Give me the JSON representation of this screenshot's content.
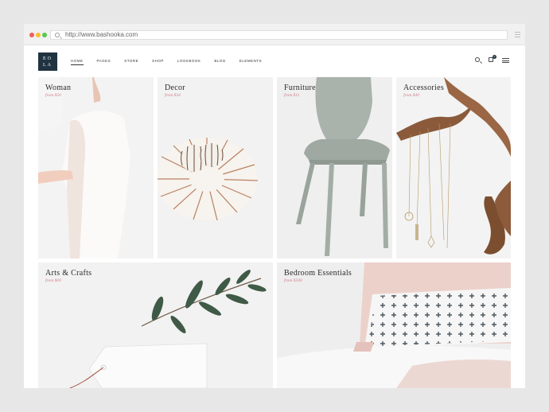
{
  "browser": {
    "url": "http://www.bashooka.com"
  },
  "header": {
    "logo": {
      "line1": "EO",
      "line2": "LA"
    },
    "nav": [
      "HOME",
      "PAGES",
      "STORE",
      "SHOP",
      "LOOKBOOK",
      "BLOG",
      "ELEMENTS"
    ],
    "active_nav": "HOME",
    "icons": [
      "search-icon",
      "shopping-bag-icon",
      "hamburger-menu-icon"
    ],
    "cart_count": "0"
  },
  "categories": [
    {
      "title": "Woman",
      "price": "from $50"
    },
    {
      "title": "Decor",
      "price": "from $34"
    },
    {
      "title": "Furniture",
      "price": "from $11"
    },
    {
      "title": "Accessories",
      "price": "from $40"
    },
    {
      "title": "Arts & Crafts",
      "price": "from $69"
    },
    {
      "title": "Bedroom Essentials",
      "price": "from $330"
    }
  ],
  "colors": {
    "logo_bg": "#1f3340",
    "price_accent": "#d07c8a",
    "page_bg": "#e7e7e8"
  }
}
